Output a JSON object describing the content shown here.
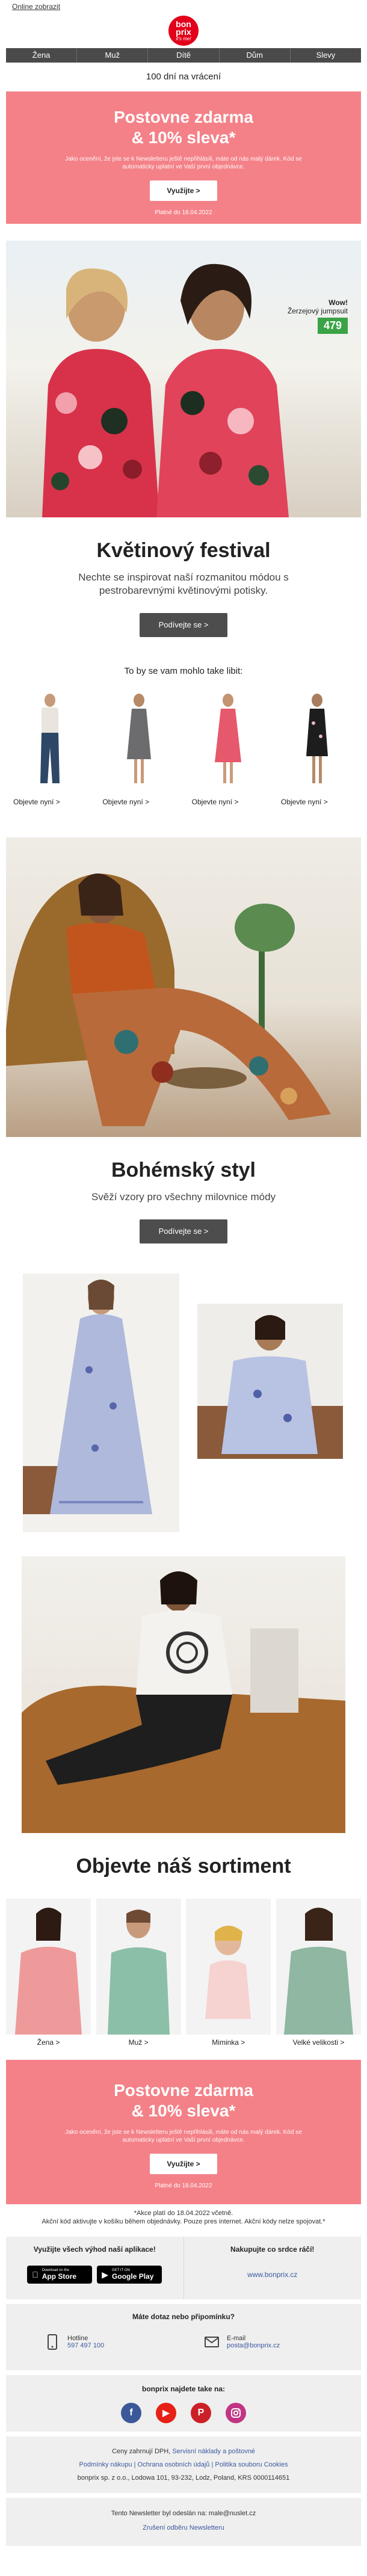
{
  "topbar": {
    "online_link": "Online zobrazit"
  },
  "logo": {
    "line1": "bon",
    "line2": "prix",
    "line3": "it's me!"
  },
  "nav": [
    "Žena",
    "Muž",
    "Dítě",
    "Dům",
    "Slevy"
  ],
  "returns_text": "100 dní na vrácení",
  "promo": {
    "title_line1": "Postovne zdarma",
    "title_line2": "& 10% sleva*",
    "text": "Jako ocenění, že jste se k Newsletteru ještě nepřihlásili, máte od nás malý dárek. Kód se automaticky uplatní ve Vaší první objednávce.",
    "button": "Využijte >",
    "valid": "Platné do 18.04.2022"
  },
  "hero": {
    "brand": "Wow!",
    "product": "Žerzejový jumpsuit",
    "price": "479"
  },
  "section1": {
    "title": "Květinový festival",
    "subtitle": "Nechte se inspirovat naší rozmanitou módou s pestrobarevnými květinovými potisky.",
    "button": "Podívejte se >"
  },
  "reco": {
    "heading": "To by se vam mohlo take libit:",
    "items": [
      {
        "label": "Objevte nyní >"
      },
      {
        "label": "Objevte nyní >"
      },
      {
        "label": "Objevte nyní >"
      },
      {
        "label": "Objevte nyní >"
      }
    ]
  },
  "section2": {
    "title": "Bohémský styl",
    "subtitle": "Svěží vzory pro všechny milovnice módy",
    "button": "Podívejte se >"
  },
  "section3": {
    "title": "Objevte náš sortiment"
  },
  "categories": [
    {
      "label": "Žena >"
    },
    {
      "label": "Muž >"
    },
    {
      "label": "Miminka >"
    },
    {
      "label": "Velké velikosti >"
    }
  ],
  "promo2": {
    "title_line1": "Postovne zdarma",
    "title_line2": "& 10% sleva*",
    "text": "Jako ocenění, že jste se k Newsletteru ještě nepřihlásili, máte od nás malý dárek. Kód se automaticky uplatní ve Vaší první objednávce.",
    "button": "Využijte >",
    "valid": "Platné do 18.04.2022"
  },
  "legal": {
    "line1": "*Akce platí do 18.04.2022 včetně.",
    "line2": "Akční kód aktivujte v košíku během objednávky. Pouze pres internet. Akční kódy nelze spojovat.*"
  },
  "apps": {
    "heading": "Využijte všech výhod naší aplikace!",
    "appstore_small": "Download on the",
    "appstore_big": "App Store",
    "google_small": "GET IT ON",
    "google_big": "Google Play",
    "shop_heading": "Nakupujte co srdce ráčí!",
    "shop_url": "www.bonprix.cz"
  },
  "contact": {
    "heading": "Máte dotaz nebo připomínku?",
    "hotline_label": "Hotline",
    "hotline_number": "597 497 100",
    "email_label": "E-mail",
    "email_value": "posta@bonprix.cz"
  },
  "social": {
    "heading": "bonprix najdete take na:"
  },
  "footer": {
    "prices_text": "Ceny zahrnují DPH,",
    "prices_link": "Servisní náklady a poštovné",
    "links": "Podmínky nákupu | Ochrana osobních údajů | Politika souboru Cookies",
    "company": "bonprix sp. z o.o., Lodowa 101, 93-232, Lodz, Poland, KRS 0000114651"
  },
  "newsletter": {
    "sent_text": "Tento Newsletter byl odeslán na: male@nuslet.cz",
    "unsubscribe": "Zrušení odběru Newsletteru"
  },
  "colors": {
    "brand_red": "#e2001a",
    "promo_pink": "#f48188",
    "nav_gray": "#4a4a4a",
    "price_green": "#3aa346",
    "link_blue": "#3b5a9e"
  }
}
